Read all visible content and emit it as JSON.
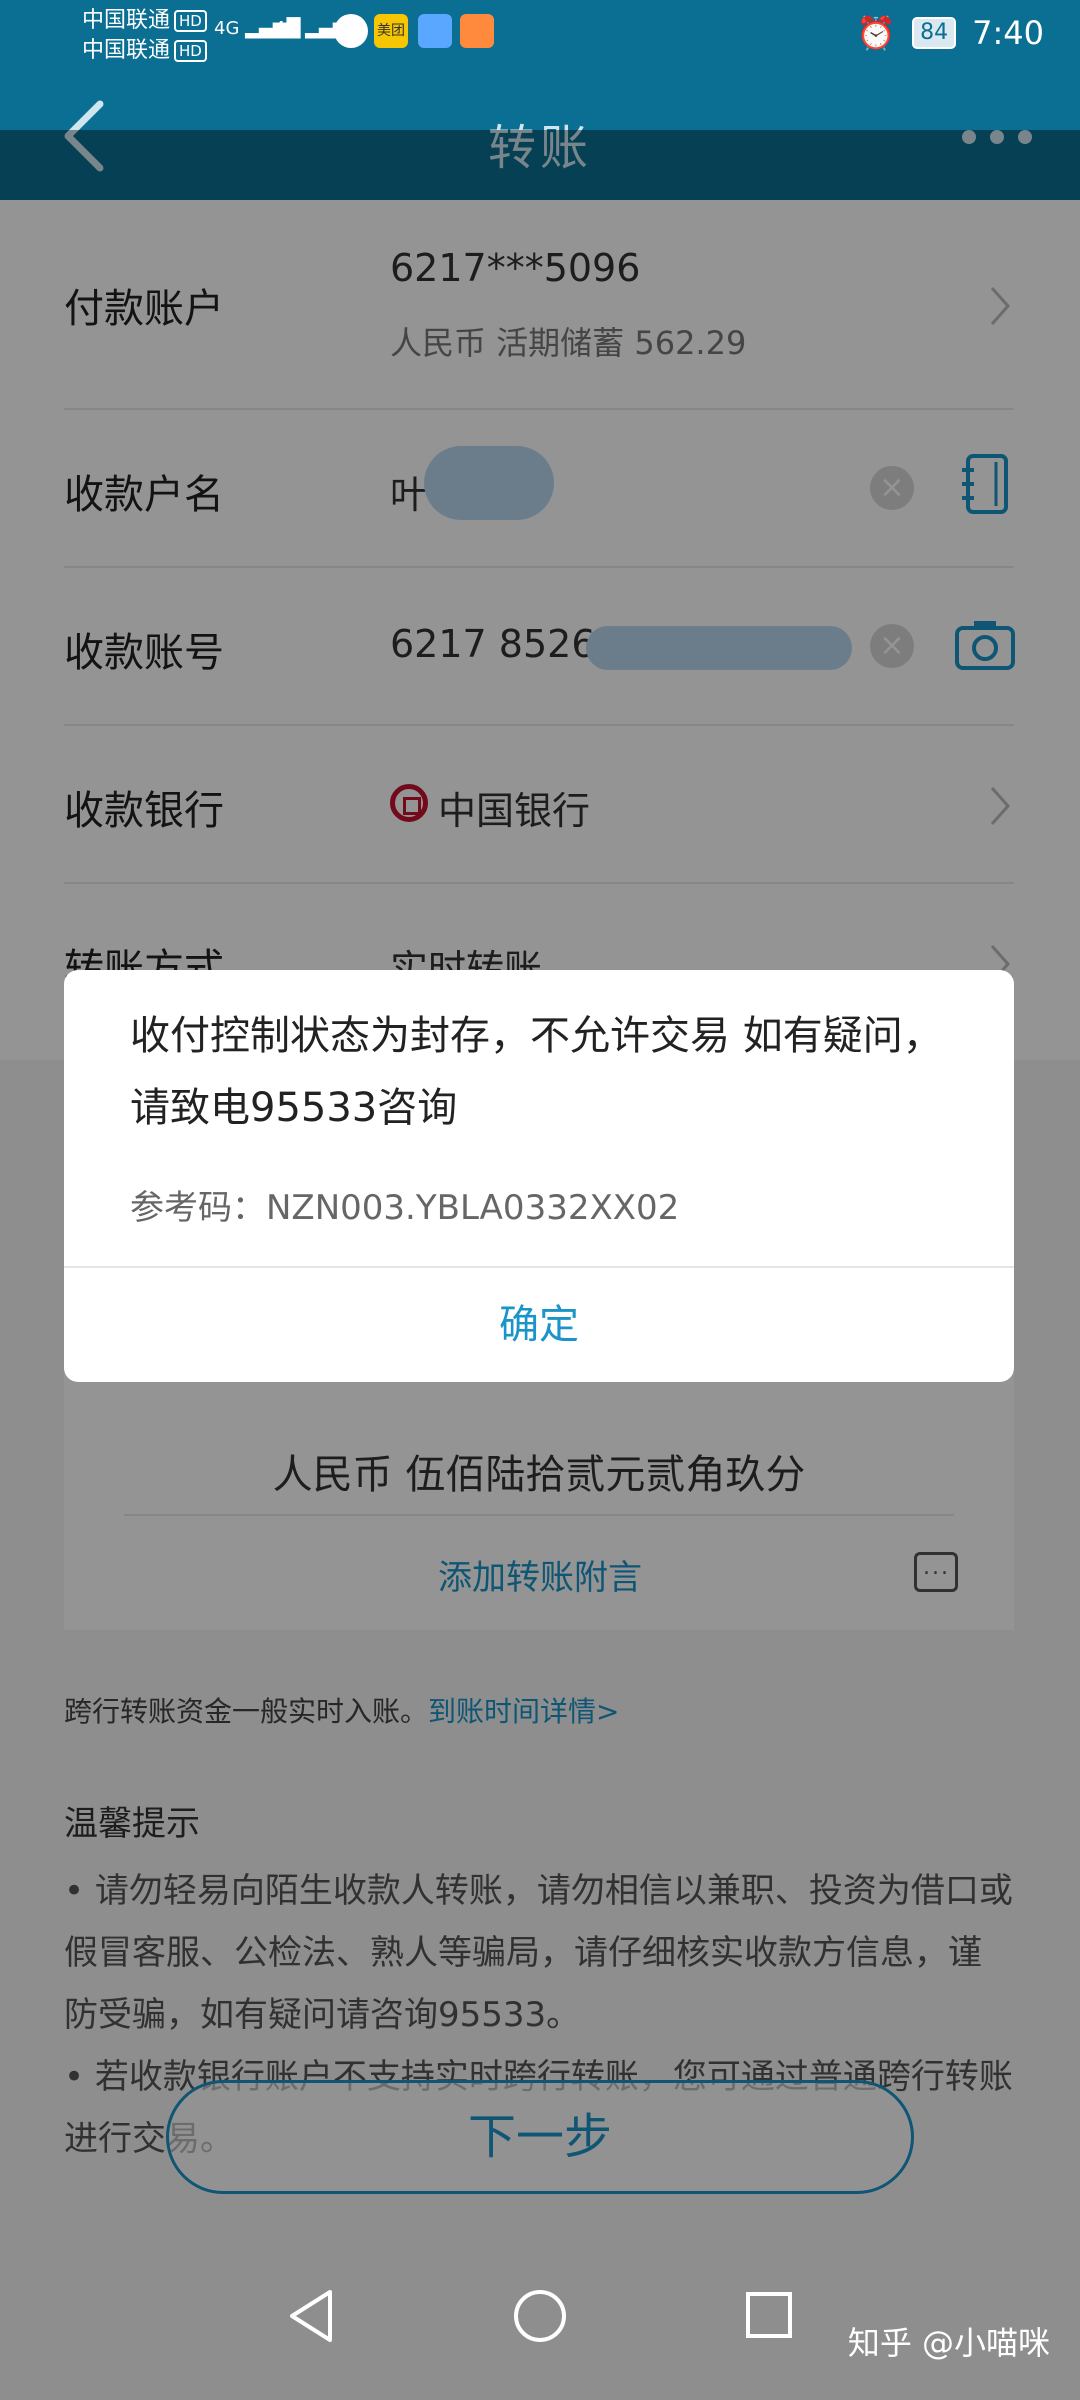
{
  "status_bar": {
    "carrier_1": "中国联通",
    "carrier_2": "中国联通",
    "hd_badge": "HD",
    "signal_label": "4G",
    "app_icon_meituan": "美团",
    "battery_level": "84",
    "time": "7:40"
  },
  "nav": {
    "title": "转账"
  },
  "form": {
    "payer": {
      "label": "付款账户",
      "account_number": "6217***5096",
      "account_detail": "人民币  活期储蓄  562.29"
    },
    "payee_name": {
      "label": "收款户名",
      "value_visible": "叶"
    },
    "payee_account": {
      "label": "收款账号",
      "value_visible": "6217 8526"
    },
    "payee_bank": {
      "label": "收款银行",
      "value": "中国银行"
    },
    "transfer_method": {
      "label": "转账方式",
      "value": "实时转账"
    }
  },
  "amount": {
    "amount_in_words": "人民币  伍佰陆拾贰元贰角玖分",
    "add_memo_link": "添加转账附言"
  },
  "arrival_note": {
    "text": "跨行转账资金一般实时入账。",
    "link": "到账时间详情>"
  },
  "tips": {
    "title": "温馨提示",
    "items": [
      "• 请勿轻易向陌生收款人转账，请勿相信以兼职、投资为借口或假冒客服、公检法、熟人等骗局，请仔细核实收款方信息，谨防受骗，如有疑问请咨询95533。",
      "• 若收款银行账户不支持实时跨行转账，您可通过普通跨行转账进行交易。"
    ]
  },
  "next_button": "下一步",
  "dialog": {
    "message": "收付控制状态为封存，不允许交易 如有疑问，请致电95533咨询",
    "reference": "参考码：NZN003.YBLA0332XX02",
    "confirm": "确定"
  },
  "watermark": "知乎 @小喵咪",
  "colors": {
    "brand_teal": "#0a6f93",
    "link_blue": "#1a94c9",
    "boc_red": "#c4122f"
  }
}
